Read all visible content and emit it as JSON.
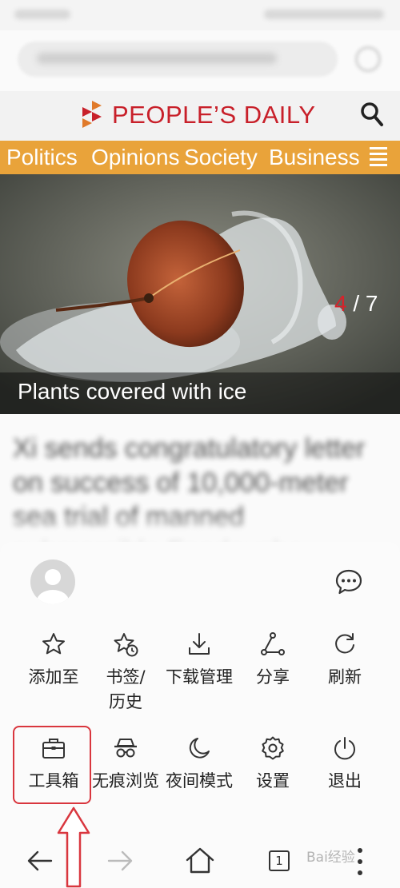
{
  "site": {
    "logo_text": "PEOPLE’S DAILY"
  },
  "nav": {
    "items": [
      "Politics",
      "Opinions",
      "Society",
      "Business"
    ]
  },
  "slideshow": {
    "caption": "Plants covered with ice",
    "current": "4",
    "separator": "/",
    "total": "7"
  },
  "headline": "Xi sends congratulatory letter on success of 10,000-meter sea trial of manned submersible Fendouzhe",
  "menu": {
    "items": [
      {
        "label": "添加至",
        "icon": "star-icon"
      },
      {
        "label": "书签/历史",
        "icon": "bookmark-history-icon"
      },
      {
        "label": "下载管理",
        "icon": "download-icon"
      },
      {
        "label": "分享",
        "icon": "share-icon"
      },
      {
        "label": "刷新",
        "icon": "refresh-icon"
      },
      {
        "label": "工具箱",
        "icon": "toolbox-icon"
      },
      {
        "label": "无痕浏览",
        "icon": "incognito-icon"
      },
      {
        "label": "夜间模式",
        "icon": "moon-icon"
      },
      {
        "label": "设置",
        "icon": "gear-icon"
      },
      {
        "label": "退出",
        "icon": "power-icon"
      }
    ]
  },
  "bottom_nav": {
    "tab_count": "1"
  },
  "watermark": "Bai经验",
  "colors": {
    "brand_red": "#c8202a",
    "nav_orange": "#e9a33a",
    "highlight_red": "#d9363e"
  }
}
